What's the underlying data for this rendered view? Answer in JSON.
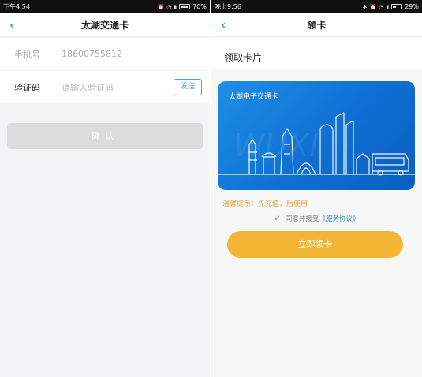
{
  "left": {
    "status": {
      "time": "下午4:54",
      "battery": "70%",
      "battery_fraction": 0.7
    },
    "title": "太湖交通卡",
    "phone_label": "手机号",
    "phone_value": "18600755812",
    "code_label": "验证码",
    "code_placeholder": "请输入验证码",
    "send_label": "发送",
    "confirm_label": "确认"
  },
  "right": {
    "status": {
      "time": "晚上9:56",
      "battery": "29%",
      "battery_fraction": 0.29
    },
    "title": "领卡",
    "section_title": "领取卡片",
    "card_title": "太湖电子交通卡",
    "tip": "温馨提示：先充值，后使用",
    "agree_prefix": "同意并接受",
    "agree_link": "《服务协议》",
    "get_label": "立即领卡"
  },
  "colors": {
    "accent": "#2aa3c4",
    "card": "#1278d8",
    "button": "#f3b534",
    "tip": "#e8a23a"
  }
}
